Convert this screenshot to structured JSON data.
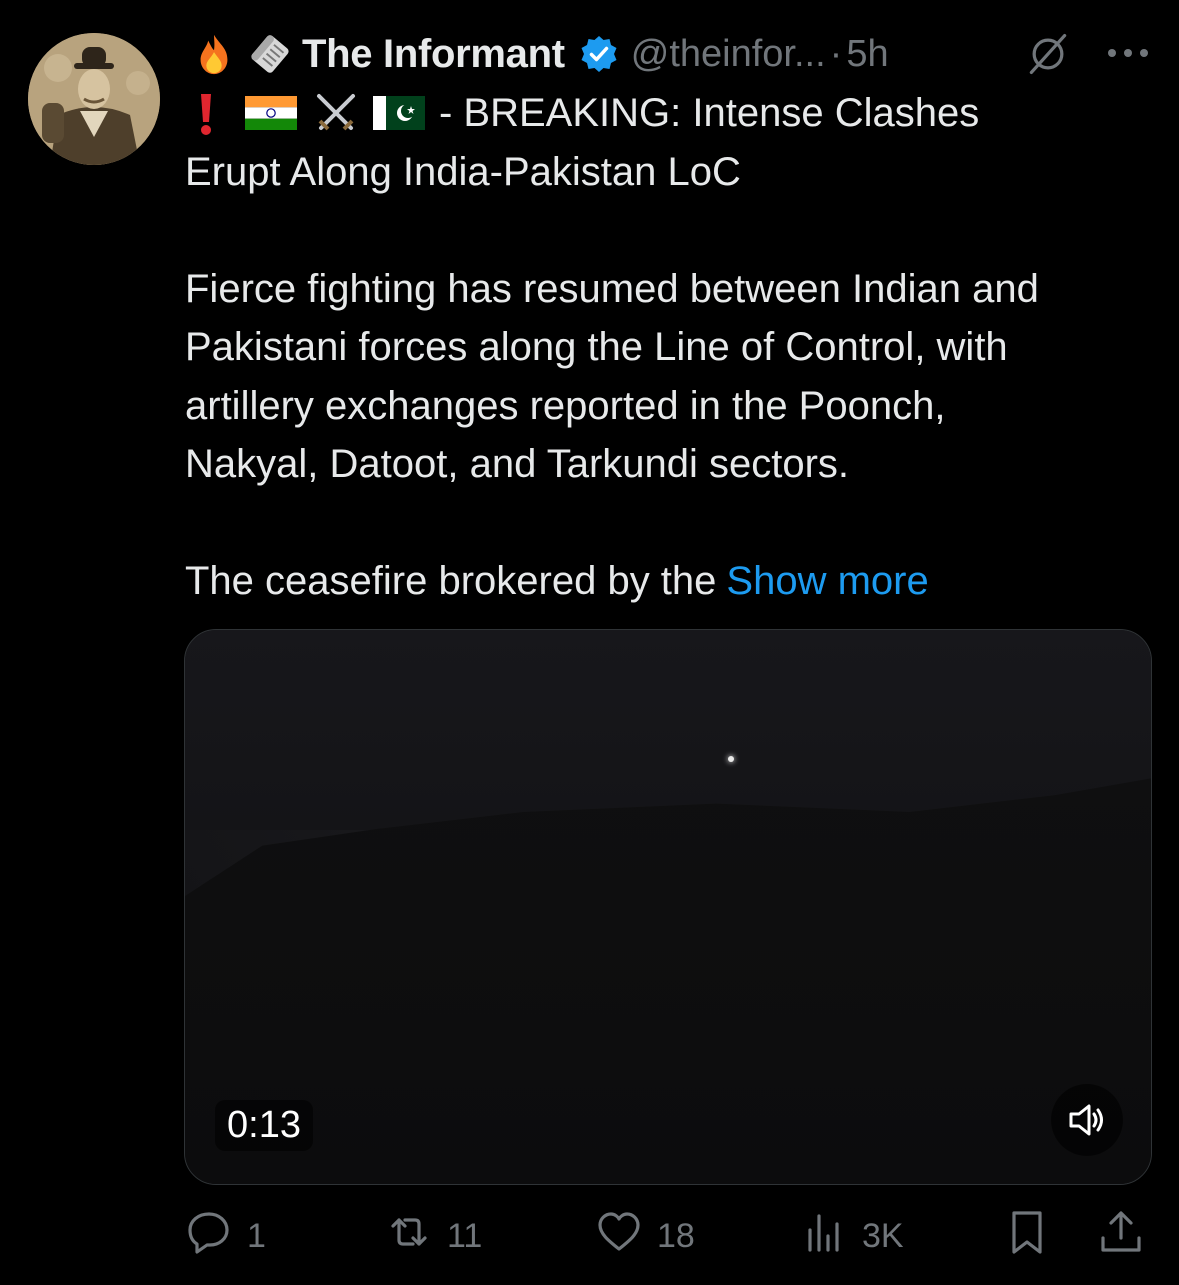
{
  "author": {
    "display_name": "The Informant",
    "handle": "@theinfor...",
    "separator": "·",
    "time": "5h",
    "verified": true
  },
  "icons": {
    "name_prefix": [
      "fire-icon",
      "rolled-newspaper-icon"
    ],
    "headline_prefix": [
      "exclamation-icon",
      "india-flag-icon",
      "crossed-swords-icon",
      "pakistan-flag-icon"
    ],
    "header_right": [
      "grok-icon",
      "more-icon"
    ]
  },
  "post": {
    "headline_line1_suffix": "- BREAKING: Intense Clashes",
    "headline_line2": "Erupt Along India-Pakistan LoC",
    "paragraph1": [
      "Fierce fighting has resumed between Indian and",
      "Pakistani forces along the Line of Control, with",
      "artillery exchanges reported in the Poonch,",
      "Nakyal, Datoot, and Tarkundi sectors."
    ],
    "paragraph2": "The ceasefire brokered by the",
    "show_more": "Show more"
  },
  "media": {
    "duration": "0:13",
    "sound_icon": "speaker-muted-icon"
  },
  "actions": {
    "replies": "1",
    "reposts": "11",
    "likes": "18",
    "views": "3K"
  },
  "colors": {
    "background": "#000000",
    "text": "#e7e9ea",
    "secondary": "#71767b",
    "accent": "#1d9bf0"
  }
}
